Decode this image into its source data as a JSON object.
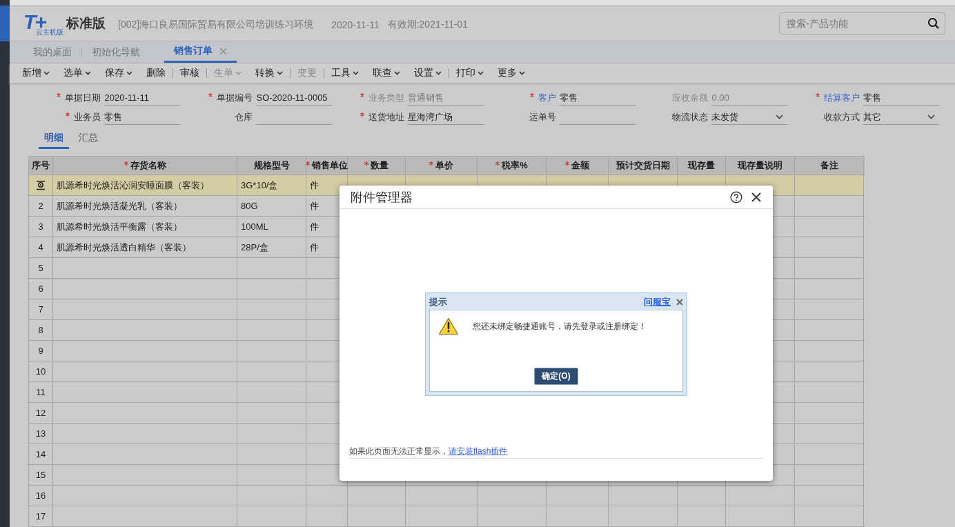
{
  "header": {
    "logo": "T+",
    "logo_sub": "云主机版",
    "edition": "标准版",
    "company": "[002]海口良易国际贸易有限公司培训练习环境",
    "date": "2020-11-11",
    "valid": "有效期:2021-11-01",
    "search": {
      "placeholder": "搜索-产品功能"
    }
  },
  "tabs": [
    {
      "label": "我的桌面",
      "selected": false,
      "closable": false
    },
    {
      "label": "初始化导航",
      "selected": false,
      "closable": false
    },
    {
      "label": "销售订单",
      "selected": true,
      "closable": true
    }
  ],
  "toolbar": [
    {
      "label": "新增",
      "dropdown": true,
      "disabled": false,
      "separator_after": false
    },
    {
      "label": "选单",
      "dropdown": true,
      "disabled": false,
      "separator_after": false
    },
    {
      "label": "保存",
      "dropdown": true,
      "disabled": false,
      "separator_after": false
    },
    {
      "label": "删除",
      "dropdown": false,
      "disabled": false,
      "separator_after": true
    },
    {
      "label": "审核",
      "dropdown": false,
      "disabled": false,
      "separator_after": true
    },
    {
      "label": "生单",
      "dropdown": true,
      "disabled": true,
      "separator_after": false
    },
    {
      "label": "转换",
      "dropdown": true,
      "disabled": false,
      "separator_after": true
    },
    {
      "label": "变更",
      "dropdown": false,
      "disabled": true,
      "separator_after": true
    },
    {
      "label": "工具",
      "dropdown": true,
      "disabled": false,
      "separator_after": false
    },
    {
      "label": "联查",
      "dropdown": true,
      "disabled": false,
      "separator_after": false
    },
    {
      "label": "设置",
      "dropdown": true,
      "disabled": false,
      "separator_after": true
    },
    {
      "label": "打印",
      "dropdown": true,
      "disabled": false,
      "separator_after": false
    },
    {
      "label": "更多",
      "dropdown": true,
      "disabled": false,
      "separator_after": false
    }
  ],
  "form": [
    {
      "label": "单据日期",
      "value": "2020-11-11",
      "required": true,
      "linked": false,
      "disabled": false,
      "kind": "text"
    },
    {
      "label": "单据编号",
      "value": "SO-2020-11-0005",
      "required": true,
      "linked": false,
      "disabled": false,
      "kind": "text"
    },
    {
      "label": "业务类型",
      "value": "普通销售",
      "required": true,
      "linked": false,
      "disabled": true,
      "kind": "text"
    },
    {
      "label": "客户",
      "value": "零售",
      "required": true,
      "linked": true,
      "disabled": false,
      "kind": "text"
    },
    {
      "label": "应收余额",
      "value": "0.00",
      "required": false,
      "linked": false,
      "disabled": true,
      "kind": "text"
    },
    {
      "label": "结算客户",
      "value": "零售",
      "required": true,
      "linked": true,
      "disabled": false,
      "kind": "text"
    },
    {
      "label": "业务员",
      "value": "零售",
      "required": true,
      "linked": false,
      "disabled": false,
      "kind": "text"
    },
    {
      "label": "仓库",
      "required": false,
      "linked": false,
      "disabled": false,
      "kind": "text"
    },
    {
      "label": "送货地址",
      "value": "星海湾广场",
      "required": true,
      "linked": false,
      "disabled": false,
      "kind": "text"
    },
    {
      "label": "运单号",
      "required": false,
      "linked": false,
      "disabled": false,
      "kind": "text"
    },
    {
      "label": "物流状态",
      "value": "未发货",
      "required": false,
      "linked": false,
      "disabled": false,
      "kind": "select"
    },
    {
      "label": "收款方式",
      "value": "其它",
      "required": false,
      "linked": false,
      "disabled": false,
      "kind": "select"
    }
  ],
  "detail_tabs": [
    {
      "label": "明细",
      "selected": true
    },
    {
      "label": "汇总",
      "selected": false
    }
  ],
  "table": {
    "columns": [
      {
        "label": "序号",
        "required": false
      },
      {
        "label": "存货名称",
        "required": true
      },
      {
        "label": "规格型号",
        "required": false
      },
      {
        "label": "销售单位",
        "required": true
      },
      {
        "label": "数量",
        "required": true
      },
      {
        "label": "单价",
        "required": true
      },
      {
        "label": "税率%",
        "required": true
      },
      {
        "label": "金额",
        "required": true
      },
      {
        "label": "预计交货日期",
        "required": false
      },
      {
        "label": "现存量",
        "required": false
      },
      {
        "label": "现存量说明",
        "required": false
      },
      {
        "label": "备注",
        "required": false
      }
    ],
    "rows": [
      {
        "selected": true,
        "name": "肌源希时光焕活沁润安睡面膜（客装）",
        "spec": "3G*10/盒",
        "unit": "件"
      },
      {
        "selected": false,
        "no": "2",
        "name": "肌源希时光焕活凝光乳（客装）",
        "spec": "80G",
        "unit": "件"
      },
      {
        "selected": false,
        "no": "3",
        "name": "肌源希时光焕活平衡露（客装）",
        "spec": "100ML",
        "unit": "件"
      },
      {
        "selected": false,
        "no": "4",
        "name": "肌源希时光焕活透白精华（客装）",
        "spec": "28P/盒",
        "unit": "件"
      },
      {
        "selected": false,
        "no": "5"
      },
      {
        "selected": false,
        "no": "6"
      },
      {
        "selected": false,
        "no": "7"
      },
      {
        "selected": false,
        "no": "8"
      },
      {
        "selected": false,
        "no": "9"
      },
      {
        "selected": false,
        "no": "10"
      },
      {
        "selected": false,
        "no": "11"
      },
      {
        "selected": false,
        "no": "12"
      },
      {
        "selected": false,
        "no": "13"
      },
      {
        "selected": false,
        "no": "14"
      },
      {
        "selected": false,
        "no": "15"
      },
      {
        "selected": false,
        "no": "16"
      },
      {
        "selected": false,
        "no": "17"
      }
    ]
  },
  "modal": {
    "title": "附件管理器",
    "footer_text": "如果此页面无法正常显示，",
    "footer_link": "请安装flash插件",
    "prompt": {
      "title": "提示",
      "link": "问服宝",
      "message": "您还未绑定畅捷通账号，请先登录或注册绑定！",
      "button": "确定(O)"
    }
  }
}
